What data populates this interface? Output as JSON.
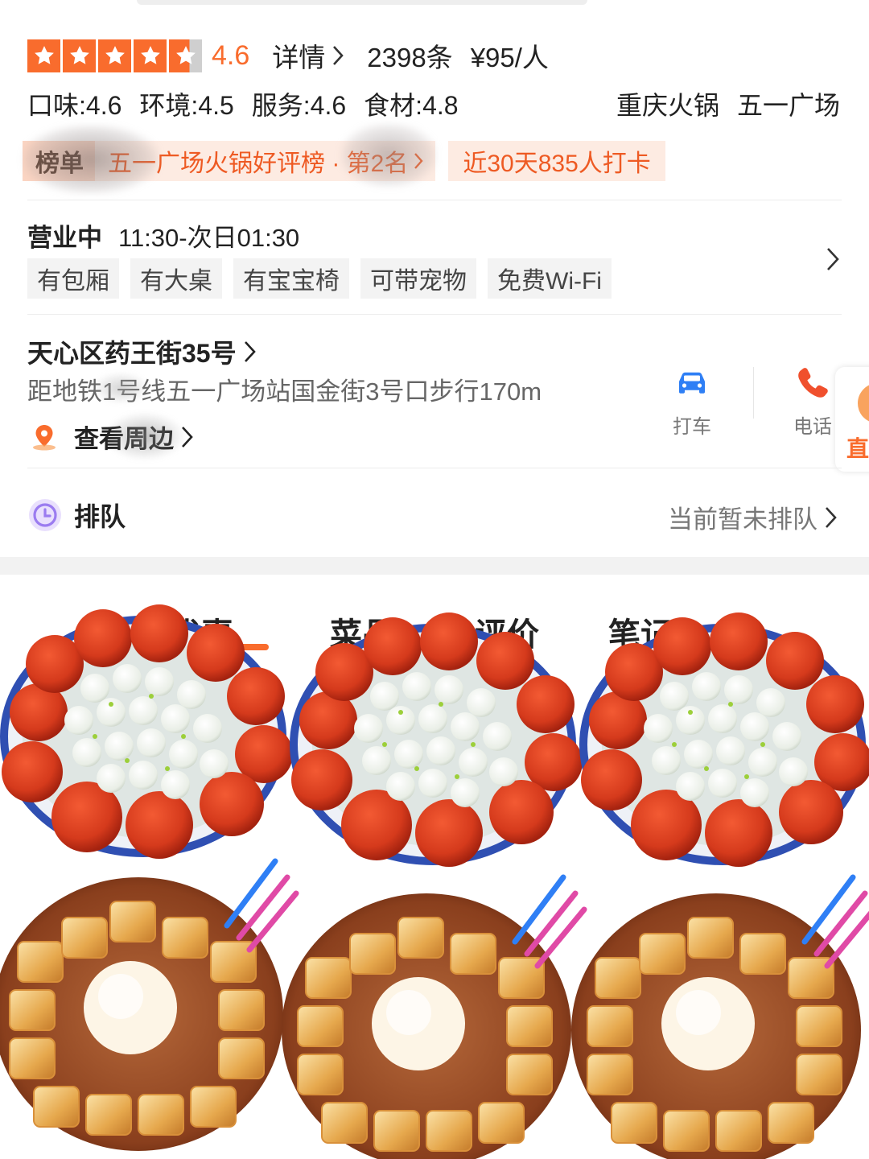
{
  "rating": {
    "stars_filled": 4.5,
    "score": "4.6",
    "detail_label": "详情",
    "review_count": "2398条",
    "price_per_person": "¥95/人"
  },
  "subscores": {
    "taste": "口味:4.6",
    "environment": "环境:4.5",
    "service": "服务:4.6",
    "ingredients": "食材:4.8"
  },
  "category": {
    "cuisine": "重庆火锅",
    "area": "五一广场"
  },
  "ranking": {
    "badge_label": "榜单",
    "rank_text": "五一广场火锅好评榜 · 第2名",
    "checkin_text": "近30天835人打卡"
  },
  "hours": {
    "status": "营业中",
    "time": "11:30-次日01:30"
  },
  "facilities": [
    "有包厢",
    "有大桌",
    "有宝宝椅",
    "可带宠物",
    "免费Wi-Fi"
  ],
  "address": {
    "street": "天心区药王街35号",
    "subway": "距地铁1号线五一广场站国金街3号口步行170m",
    "nearby_label": "查看周边"
  },
  "actions": {
    "taxi_label": "打车",
    "phone_label": "电话",
    "live_label": "直"
  },
  "queue": {
    "label": "排队",
    "status": "当前暂未排队"
  },
  "tabs": [
    "优惠",
    "菜品",
    "评价",
    "笔记"
  ],
  "colors": {
    "accent": "#f96c2d",
    "taxi_blue": "#2f7ff5",
    "phone_red": "#f0502d",
    "queue_purple": "#9b7cf0"
  }
}
